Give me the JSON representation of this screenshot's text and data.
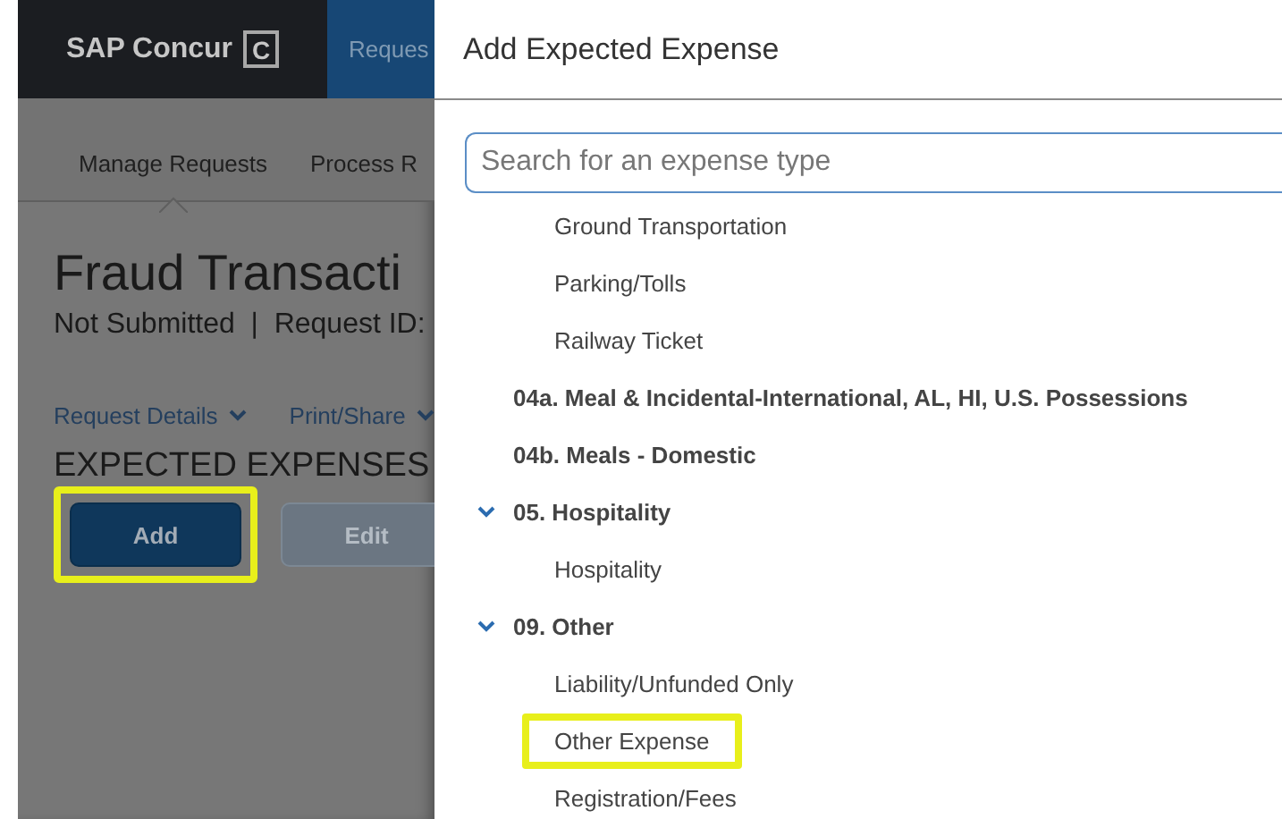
{
  "background_page": {
    "logo": "SAP Concur",
    "logo_mark": "C",
    "top_tab": "Reques",
    "subnav": [
      {
        "label": "Manage Requests",
        "selected": true
      },
      {
        "label": "Process R",
        "selected": false
      }
    ],
    "title": "Fraud Transacti",
    "status_line": "Not Submitted  |  Request ID: ",
    "menus": [
      "Request Details",
      "Print/Share"
    ],
    "section_heading": "EXPECTED EXPENSES",
    "buttons": [
      {
        "label": "Add",
        "disabled": false,
        "highlighted": true
      },
      {
        "label": "Edit",
        "disabled": true,
        "highlighted": false
      }
    ]
  },
  "dialog": {
    "title": "Add Expected Expense",
    "search": {
      "placeholder": "Search for an expense type"
    },
    "items": [
      {
        "kind": "type",
        "label": "Ground Transportation",
        "highlighted": false
      },
      {
        "kind": "type",
        "label": "Parking/Tolls",
        "highlighted": false
      },
      {
        "kind": "type",
        "label": "Railway Ticket",
        "highlighted": false
      },
      {
        "kind": "category",
        "label": "04a. Meal & Incidental-International, AL, HI, U.S. Possessions"
      },
      {
        "kind": "category",
        "label": "04b. Meals - Domestic"
      },
      {
        "kind": "category",
        "label": "05. Hospitality",
        "expanded": true,
        "children": [
          {
            "kind": "type",
            "label": "Hospitality",
            "highlighted": false
          }
        ]
      },
      {
        "kind": "category",
        "label": "09. Other",
        "expanded": true,
        "children": [
          {
            "kind": "type",
            "label": "Liability/Unfunded Only",
            "highlighted": false
          },
          {
            "kind": "type",
            "label": "Other Expense",
            "highlighted": true
          },
          {
            "kind": "type",
            "label": "Registration/Fees",
            "highlighted": false
          }
        ]
      }
    ]
  }
}
